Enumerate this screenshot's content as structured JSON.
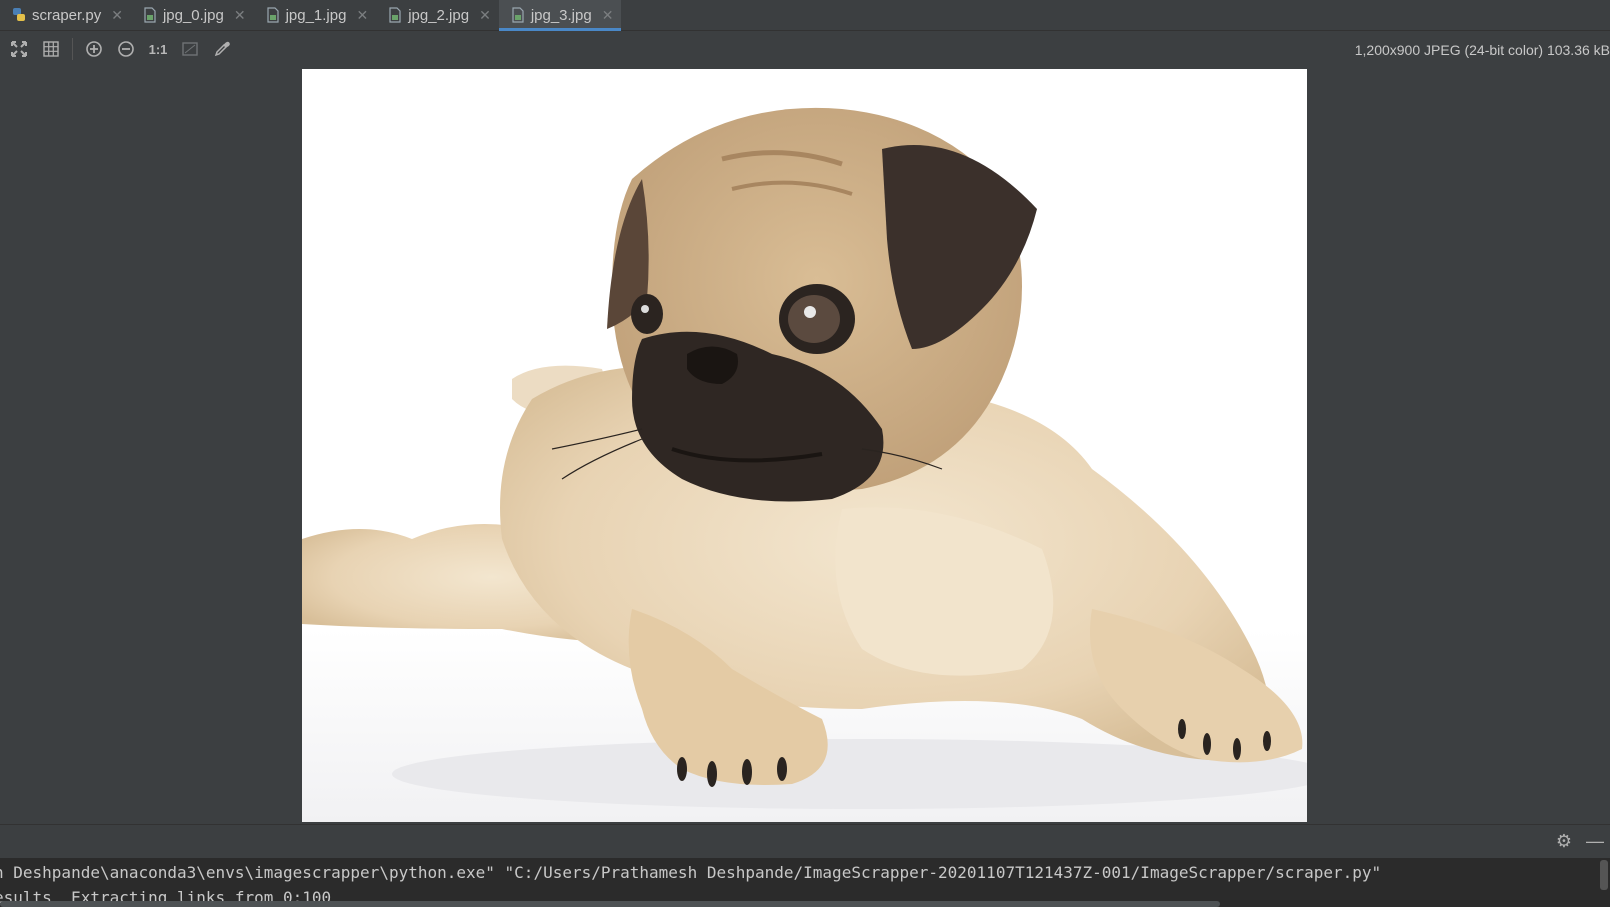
{
  "tabs": [
    {
      "label": "scraper.py",
      "icon": "python-file-icon",
      "active": false
    },
    {
      "label": "jpg_0.jpg",
      "icon": "image-file-icon",
      "active": false
    },
    {
      "label": "jpg_1.jpg",
      "icon": "image-file-icon",
      "active": false
    },
    {
      "label": "jpg_2.jpg",
      "icon": "image-file-icon",
      "active": false
    },
    {
      "label": "jpg_3.jpg",
      "icon": "image-file-icon",
      "active": true
    }
  ],
  "toolbar": {
    "actual_size_label": "1:1",
    "image_info": "1,200x900 JPEG (24-bit color) 103.36 kB"
  },
  "image": {
    "subject": "pug puppy lying down on white background"
  },
  "console": {
    "line1": "h Deshpande\\anaconda3\\envs\\imagescrapper\\python.exe\" \"C:/Users/Prathamesh Deshpande/ImageScrapper-20201107T121437Z-001/ImageScrapper/scraper.py\"",
    "line2": "esults  Extracting links from 0:100"
  },
  "colors": {
    "background": "#3c3f41",
    "active_tab_underline": "#4a88c7",
    "console_background": "#2b2b2b"
  }
}
